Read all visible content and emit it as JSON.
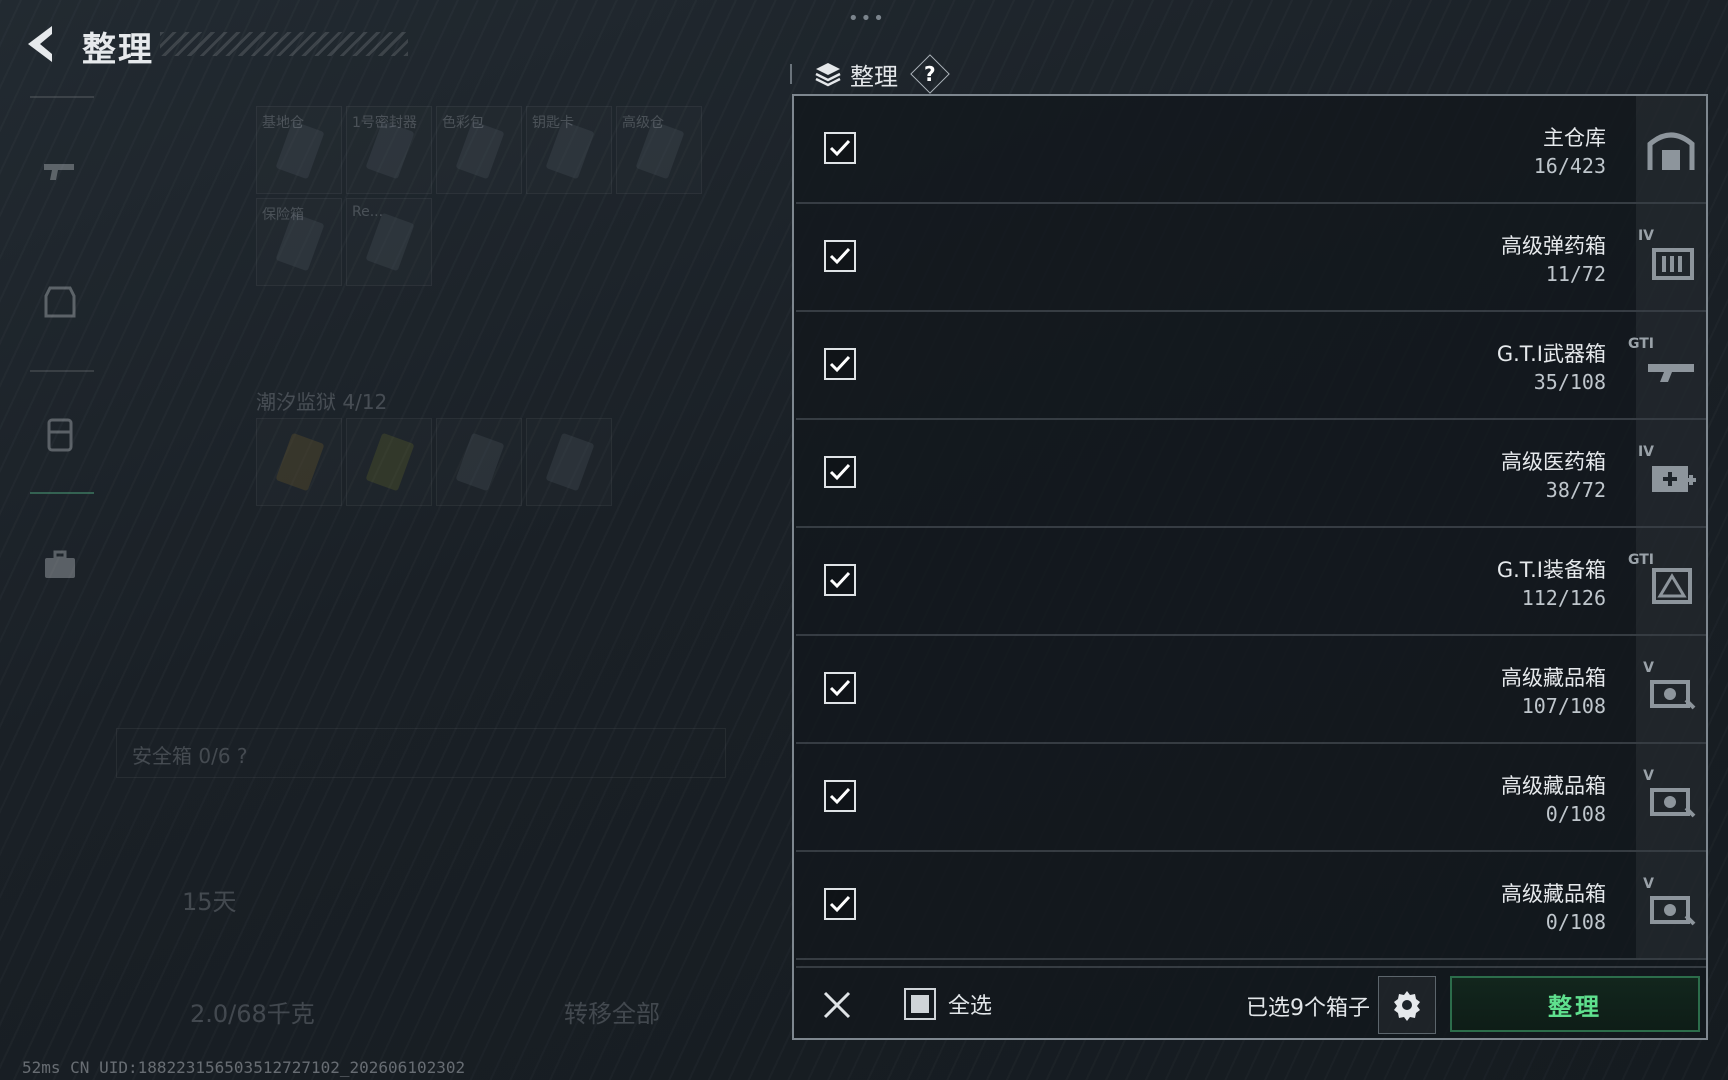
{
  "header": {
    "title": "整理",
    "back_icon": "chevron-left-icon"
  },
  "left_rail": {
    "icons": [
      "gun-icon",
      "armor-icon",
      "backpack-icon",
      "briefcase-icon"
    ]
  },
  "background": {
    "item_labels": [
      "基地仓",
      "1号密封器",
      "色彩包",
      "钥匙卡",
      "高级仓",
      "保险箱",
      "Re..."
    ],
    "section_label": "潮汐监狱 4/12",
    "safe_box": "安全箱 0/6 ?",
    "timer": "15天",
    "capacity": "2.0/68千克",
    "transfer_all": "转移全部",
    "status": "52ms    CN UID:188223156503512727102_202606102302"
  },
  "panel": {
    "title": "整理",
    "help": "?",
    "rows": [
      {
        "name": "主仓库",
        "count": "16/423",
        "icon": "warehouse-icon",
        "tier": "",
        "checked": true
      },
      {
        "name": "高级弹药箱",
        "count": "11/72",
        "icon": "ammo-box-icon",
        "tier": "IV",
        "checked": true
      },
      {
        "name": "G.T.I武器箱",
        "count": "35/108",
        "icon": "weapon-case-icon",
        "tier": "GTI",
        "checked": true
      },
      {
        "name": "高级医药箱",
        "count": "38/72",
        "icon": "medical-box-icon",
        "tier": "IV",
        "checked": true
      },
      {
        "name": "G.T.I装备箱",
        "count": "112/126",
        "icon": "gear-case-icon",
        "tier": "GTI",
        "checked": true
      },
      {
        "name": "高级藏品箱",
        "count": "107/108",
        "icon": "collectible-box-icon",
        "tier": "V",
        "checked": true
      },
      {
        "name": "高级藏品箱",
        "count": "0/108",
        "icon": "collectible-box-icon",
        "tier": "V",
        "checked": true
      },
      {
        "name": "高级藏品箱",
        "count": "0/108",
        "icon": "collectible-box-icon",
        "tier": "V",
        "checked": true
      }
    ],
    "footer": {
      "select_all": "全选",
      "selected_text": "已选9个箱子",
      "organize_button": "整理"
    }
  },
  "colors": {
    "accent_green": "#5fe08e",
    "panel_border": "#7e878f"
  }
}
